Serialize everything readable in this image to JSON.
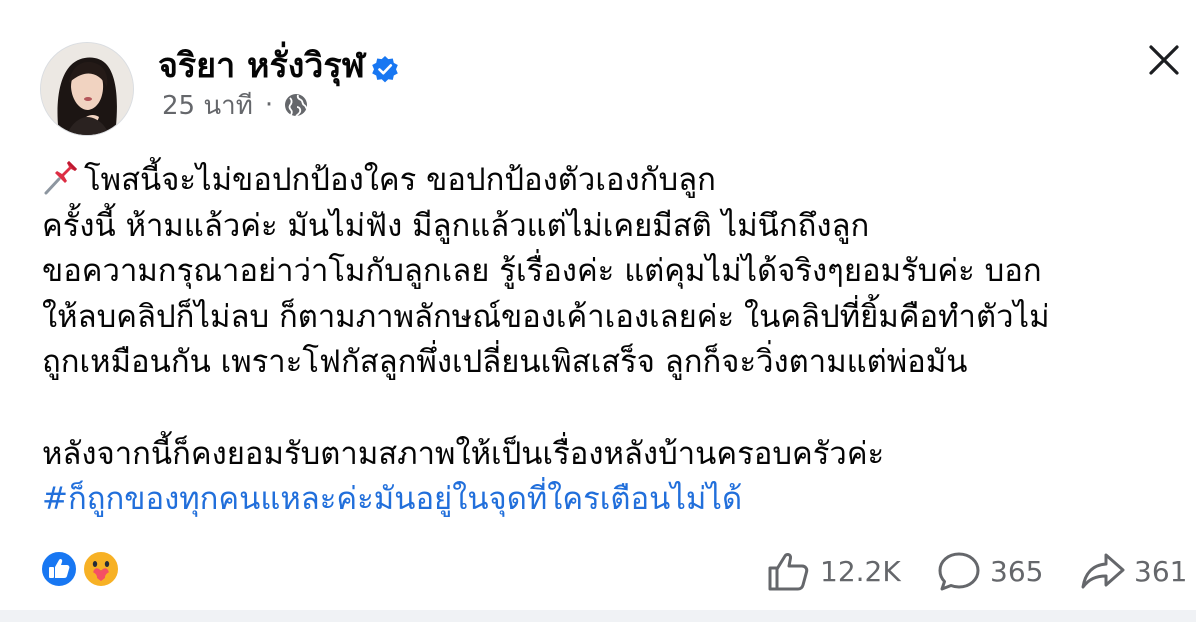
{
  "post": {
    "author": "จริยา หรั่งวิรุฬ",
    "time": "25 นาที",
    "meta_separator": "·",
    "privacy_icon": "globe-icon",
    "pin_icon": "pushpin-icon",
    "body_lines": [
      "โพสนี้จะไม่ขอปกป้องใคร ขอปกป้องตัวเองกับลูก",
      "ครั้งนี้ ห้ามแล้วค่ะ มันไม่ฟัง มีลูกแล้วแต่ไม่เคยมีสติ ไม่นึกถึงลูก",
      "ขอความกรุณาอย่าว่าโมกับลูกเลย รู้เรื่องค่ะ แต่คุมไม่ได้จริงๆยอมรับค่ะ  บอก",
      "ให้ลบคลิปก็ไม่ลบ ก็ตามภาพลักษณ์ของเค้าเองเลยค่ะ  ในคลิปที่ยิ้มคือทำตัวไม่",
      "ถูกเหมือนกัน เพราะโฟกัสลูกพึ่งเปลี่ยนเพิสเสร็จ ลูกก็จะวิ่งตามแต่พ่อมัน"
    ],
    "closing_line": "หลังจากนี้ก็คงยอมรับตามสภาพให้เป็นเรื่องหลังบ้านครอบครัวค่ะ",
    "hashtag": "#ก็ถูกของทุกคนแหละค่ะมันอยู่ในจุดที่ใครเตือนไม่ได้"
  },
  "stats": {
    "reactions": [
      "like-icon",
      "care-icon"
    ],
    "likes": "12.2K",
    "comments": "365",
    "shares": "361"
  },
  "colors": {
    "accent": "#216fdb",
    "secondary_text": "#65676b",
    "verified": "#1877f2"
  }
}
